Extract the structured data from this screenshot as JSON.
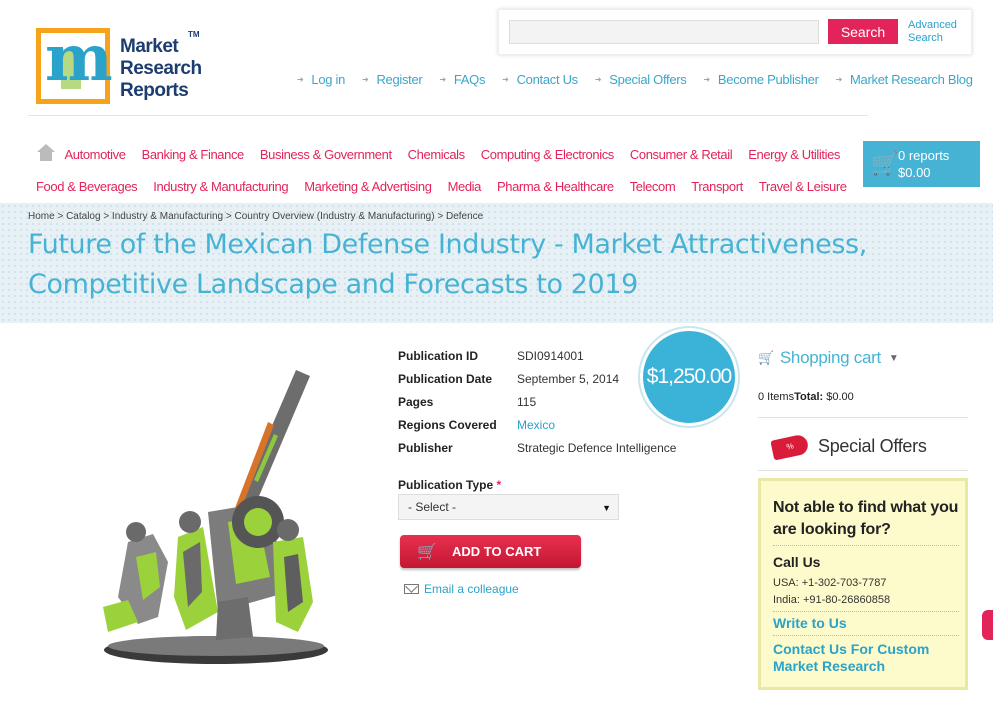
{
  "logo": {
    "line1": "Market",
    "line2": "Research",
    "line3": "Reports",
    "tm": "TM",
    "letter": "m"
  },
  "search": {
    "placeholder": "",
    "button": "Search",
    "advanced_line1": "Advanced",
    "advanced_line2": "Search"
  },
  "toplinks": [
    "Log in",
    "Register",
    "FAQs",
    "Contact Us",
    "Special Offers",
    "Become Publisher",
    "Market Research Blog"
  ],
  "categories_row1": [
    "Automotive",
    "Banking & Finance",
    "Business & Government",
    "Chemicals",
    "Computing & Electronics",
    "Consumer & Retail",
    "Energy & Utilities"
  ],
  "categories_row2": [
    "Food & Beverages",
    "Industry & Manufacturing",
    "Marketing & Advertising",
    "Media",
    "Pharma & Healthcare",
    "Telecom",
    "Transport",
    "Travel & Leisure"
  ],
  "cart": {
    "reports": "0 reports",
    "total": "$0.00"
  },
  "breadcrumb": "Home > Catalog > Industry & Manufacturing > Country Overview (Industry & Manufacturing) > Defence",
  "title": "Future of the Mexican Defense Industry - Market Attractiveness, Competitive Landscape and Forecasts to 2019",
  "details": [
    {
      "label": "Publication ID",
      "value": "SDI0914001"
    },
    {
      "label": "Publication Date",
      "value": "September 5, 2014"
    },
    {
      "label": "Pages",
      "value": "115"
    },
    {
      "label": "Regions Covered",
      "value": "Mexico"
    },
    {
      "label": "Publisher",
      "value": "Strategic Defence Intelligence"
    }
  ],
  "price": "$1,250.00",
  "publication_type": {
    "label": "Publication Type",
    "required_mark": "*",
    "selected": "- Select -"
  },
  "add_to_cart": "ADD TO CART",
  "email_colleague": "Email a colleague",
  "sidebar": {
    "shopping_cart": "Shopping cart",
    "items_count": "0 Items",
    "total_label": "Total:",
    "total_value": " $0.00",
    "special_offers": "Special Offers",
    "tag_text": "%",
    "help_question": "Not able to find what you are looking for?",
    "call_us": "Call Us",
    "phone_usa": "USA: +1-302-703-7787",
    "phone_india": "India: +91-80-26860858",
    "write_to_us": "Write to Us",
    "custom_research": "Contact Us For Custom Market Research"
  },
  "colors": {
    "accent_blue": "#47b3d4",
    "accent_pink": "#e2245a",
    "logo_orange": "#f7a21b"
  }
}
